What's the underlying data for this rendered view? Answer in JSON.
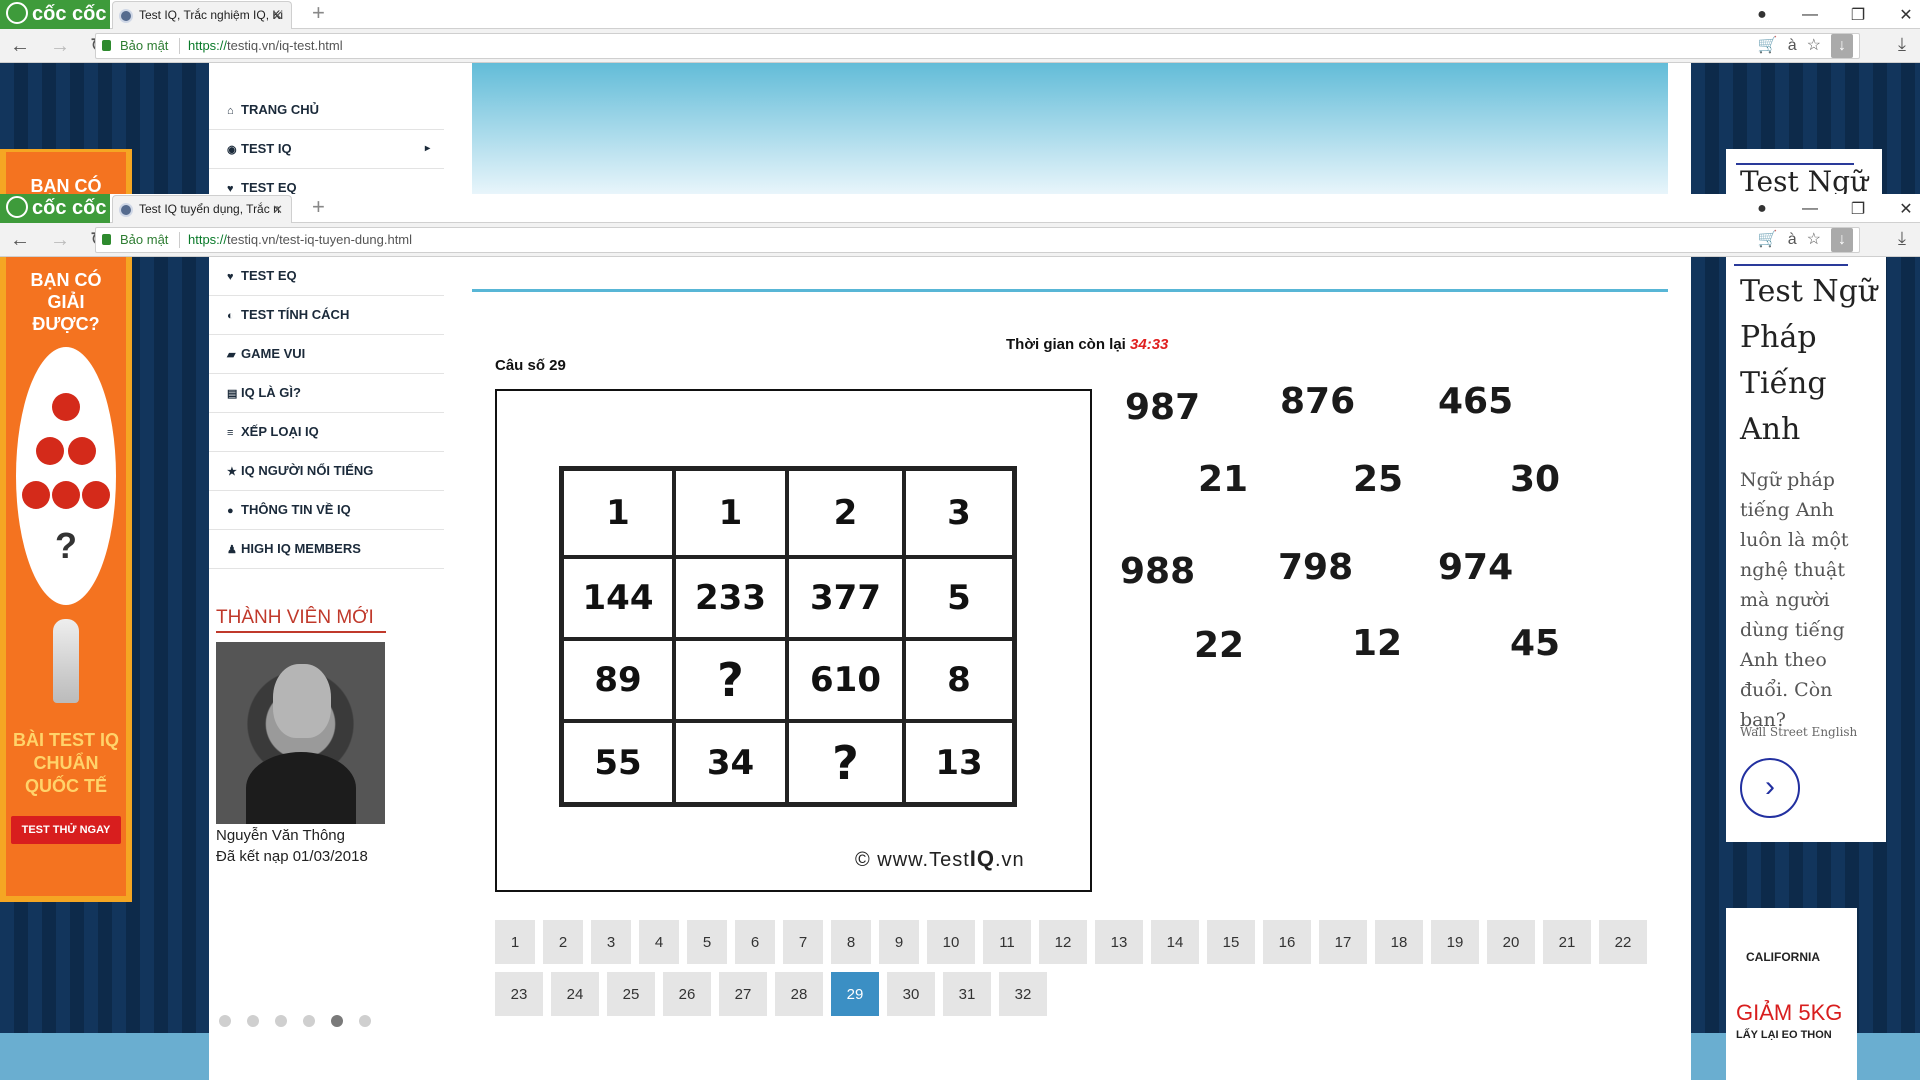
{
  "window1": {
    "brand": "cốc cốc",
    "tab_title": "Test IQ, Trắc nghiệm IQ, Ki",
    "secure_label": "Bảo mật",
    "url_scheme": "https://",
    "url_host": "testiq.vn",
    "url_path": "/iq-test.html",
    "menu": [
      {
        "icon": "home-icon",
        "glyph": "⌂",
        "label": "TRANG CHỦ"
      },
      {
        "icon": "brain-icon",
        "glyph": "◉",
        "label": "TEST IQ",
        "caret": "▸"
      },
      {
        "icon": "heart-icon",
        "glyph": "♥",
        "label": "TEST EQ"
      }
    ],
    "ad_left_text": "BẠN CÓ",
    "ad_right_text": "Test Ngữ"
  },
  "window2": {
    "brand": "cốc cốc",
    "tab_title": "Test IQ tuyển dụng, Trắc n",
    "secure_label": "Bảo mật",
    "url_scheme": "https://",
    "url_host": "testiq.vn",
    "url_path": "/test-iq-tuyen-dung.html",
    "window_controls": {
      "user": "●",
      "minimize": "—",
      "restore": "❐",
      "close": "✕"
    }
  },
  "sidebar": {
    "menu": [
      {
        "icon": "heart-icon",
        "glyph": "♥",
        "label": "TEST EQ"
      },
      {
        "icon": "personality-icon",
        "glyph": "◐",
        "label": "TEST TÍNH CÁCH"
      },
      {
        "icon": "gamepad-icon",
        "glyph": "▰",
        "label": "GAME VUI"
      },
      {
        "icon": "book-icon",
        "glyph": "▤",
        "label": "IQ LÀ GÌ?"
      },
      {
        "icon": "list-icon",
        "glyph": "≡",
        "label": "XẾP LOẠI IQ"
      },
      {
        "icon": "star-icon",
        "glyph": "★",
        "label": "IQ NGƯỜI NỔI TIẾNG"
      },
      {
        "icon": "info-icon",
        "glyph": "●",
        "label": "THÔNG TIN VỀ IQ"
      },
      {
        "icon": "members-icon",
        "glyph": "♟",
        "label": "HIGH IQ MEMBERS"
      }
    ],
    "new_member_heading": "THÀNH VIÊN MỚI",
    "member_name": "Nguyễn Văn Thông",
    "member_joined": "Đã kết nạp 01/03/2018",
    "carousel_dots": 6,
    "carousel_active": 5
  },
  "ad_left": {
    "line1": "BẠN CÓ",
    "line2": "GIẢI",
    "line3": "ĐƯỢC?",
    "question": "?",
    "bottom1": "BÀI TEST IQ",
    "bottom2": "CHUẨN",
    "bottom3": "QUỐC TẾ",
    "cta": "TEST THỬ NGAY"
  },
  "ad_right": {
    "title": "Test Ngữ Pháp Tiếng Anh",
    "body": "Ngữ pháp tiếng Anh luôn là một nghệ thuật mà người dùng tiếng Anh theo đuổi. Còn bạn?",
    "advertiser": "Wall Street English",
    "brand2": "CALIFORNIA",
    "promo": "GIẢM 5KG",
    "promo_sub": "LẤY LẠI EO THON"
  },
  "quiz": {
    "timer_label": "Thời gian còn lại",
    "timer_value": "34:33",
    "question_label": "Câu số 29",
    "grid": [
      [
        "1",
        "1",
        "2",
        "3"
      ],
      [
        "144",
        "233",
        "377",
        "5"
      ],
      [
        "89",
        "?",
        "610",
        "8"
      ],
      [
        "55",
        "34",
        "?",
        "13"
      ]
    ],
    "watermark_prefix": "© www.Test",
    "watermark_bold": "IQ",
    "watermark_suffix": ".vn",
    "options": [
      "987",
      "876",
      "465",
      "21",
      "25",
      "30",
      "988",
      "798",
      "974",
      "22",
      "12",
      "45"
    ]
  },
  "pager": {
    "pages": [
      "1",
      "2",
      "3",
      "4",
      "5",
      "6",
      "7",
      "8",
      "9",
      "10",
      "11",
      "12",
      "13",
      "14",
      "15",
      "16",
      "17",
      "18",
      "19",
      "20",
      "21",
      "22",
      "23",
      "24",
      "25",
      "26",
      "27",
      "28",
      "29",
      "30",
      "31",
      "32"
    ],
    "active": "29"
  }
}
